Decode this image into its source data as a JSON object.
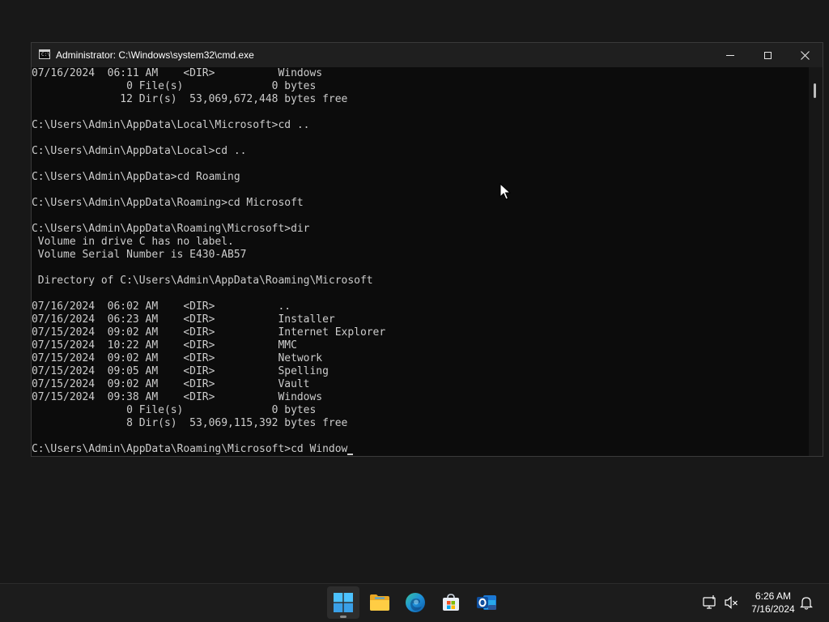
{
  "window": {
    "title": "Administrator: C:\\Windows\\system32\\cmd.exe",
    "icon": "console-icon",
    "icon_text": "C:\\"
  },
  "console": {
    "lines": [
      "07/16/2024  06:11 AM    <DIR>          Windows",
      "               0 File(s)              0 bytes",
      "              12 Dir(s)  53,069,672,448 bytes free",
      "",
      "C:\\Users\\Admin\\AppData\\Local\\Microsoft>cd ..",
      "",
      "C:\\Users\\Admin\\AppData\\Local>cd ..",
      "",
      "C:\\Users\\Admin\\AppData>cd Roaming",
      "",
      "C:\\Users\\Admin\\AppData\\Roaming>cd Microsoft",
      "",
      "C:\\Users\\Admin\\AppData\\Roaming\\Microsoft>dir",
      " Volume in drive C has no label.",
      " Volume Serial Number is E430-AB57",
      "",
      " Directory of C:\\Users\\Admin\\AppData\\Roaming\\Microsoft",
      "",
      "07/16/2024  06:02 AM    <DIR>          ..",
      "07/16/2024  06:23 AM    <DIR>          Installer",
      "07/15/2024  09:02 AM    <DIR>          Internet Explorer",
      "07/15/2024  10:22 AM    <DIR>          MMC",
      "07/15/2024  09:02 AM    <DIR>          Network",
      "07/15/2024  09:05 AM    <DIR>          Spelling",
      "07/15/2024  09:02 AM    <DIR>          Vault",
      "07/15/2024  09:38 AM    <DIR>          Windows",
      "               0 File(s)              0 bytes",
      "               8 Dir(s)  53,069,115,392 bytes free",
      ""
    ],
    "input_line": "C:\\Users\\Admin\\AppData\\Roaming\\Microsoft>cd Window"
  },
  "taskbar": {
    "apps": [
      {
        "name": "start-button",
        "icon": "windows-logo-icon",
        "active": true
      },
      {
        "name": "taskbar-file-explorer",
        "icon": "folder-icon",
        "active": false
      },
      {
        "name": "taskbar-edge",
        "icon": "edge-icon",
        "active": false
      },
      {
        "name": "taskbar-store",
        "icon": "store-icon",
        "active": false
      },
      {
        "name": "taskbar-outlook",
        "icon": "outlook-icon",
        "active": false
      }
    ],
    "tray": {
      "network_icon": "network-icon",
      "volume_icon": "volume-muted-icon",
      "notification_icon": "bell-icon"
    },
    "clock": {
      "time": "6:26 AM",
      "date": "7/16/2024"
    }
  },
  "colors": {
    "console_bg": "#0c0c0c",
    "console_text": "#cccccc",
    "titlebar": "#1f1f1f",
    "taskbar": "#1c1c1c"
  }
}
